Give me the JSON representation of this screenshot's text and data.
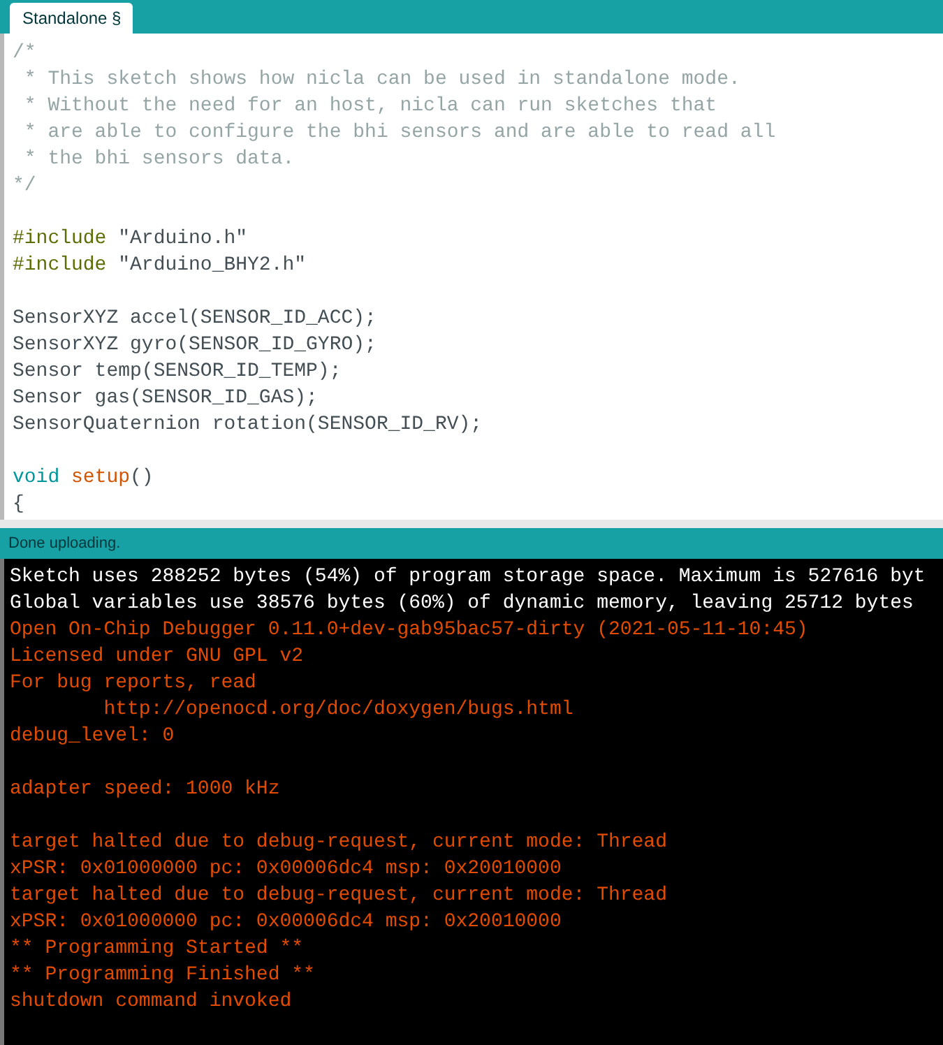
{
  "tabs": [
    {
      "label": "Standalone §",
      "selected": true
    }
  ],
  "editor": {
    "lines": [
      {
        "kind": "code",
        "segments": [
          {
            "text": "/*",
            "kind": "comment"
          }
        ]
      },
      {
        "kind": "code",
        "segments": [
          {
            "text": " * This sketch shows how nicla can be used in standalone mode.",
            "kind": "comment"
          }
        ]
      },
      {
        "kind": "code",
        "segments": [
          {
            "text": " * Without the need for an host, nicla can run sketches that",
            "kind": "comment"
          }
        ]
      },
      {
        "kind": "code",
        "segments": [
          {
            "text": " * are able to configure the bhi sensors and are able to read all",
            "kind": "comment"
          }
        ]
      },
      {
        "kind": "code",
        "segments": [
          {
            "text": " * the bhi sensors data.",
            "kind": "comment"
          }
        ]
      },
      {
        "kind": "code",
        "segments": [
          {
            "text": "*/",
            "kind": "comment"
          }
        ]
      },
      {
        "kind": "blank"
      },
      {
        "kind": "code",
        "segments": [
          {
            "text": "#include",
            "kind": "directive"
          },
          {
            "text": " \"Arduino.h\"",
            "kind": "plain"
          }
        ]
      },
      {
        "kind": "code",
        "segments": [
          {
            "text": "#include",
            "kind": "directive"
          },
          {
            "text": " \"Arduino_BHY2.h\"",
            "kind": "plain"
          }
        ]
      },
      {
        "kind": "blank"
      },
      {
        "kind": "code",
        "segments": [
          {
            "text": "SensorXYZ accel(SENSOR_ID_ACC);",
            "kind": "plain"
          }
        ]
      },
      {
        "kind": "code",
        "segments": [
          {
            "text": "SensorXYZ gyro(SENSOR_ID_GYRO);",
            "kind": "plain"
          }
        ]
      },
      {
        "kind": "code",
        "segments": [
          {
            "text": "Sensor temp(SENSOR_ID_TEMP);",
            "kind": "plain"
          }
        ]
      },
      {
        "kind": "code",
        "segments": [
          {
            "text": "Sensor gas(SENSOR_ID_GAS);",
            "kind": "plain"
          }
        ]
      },
      {
        "kind": "code",
        "segments": [
          {
            "text": "SensorQuaternion rotation(SENSOR_ID_RV);",
            "kind": "plain"
          }
        ]
      },
      {
        "kind": "blank"
      },
      {
        "kind": "code",
        "segments": [
          {
            "text": "void",
            "kind": "keyword"
          },
          {
            "text": " setup",
            "kind": "function"
          },
          {
            "text": "()",
            "kind": "plain"
          }
        ]
      },
      {
        "kind": "code",
        "segments": [
          {
            "text": "{",
            "kind": "plain"
          }
        ]
      }
    ]
  },
  "status_bar": {
    "message": "Done uploading."
  },
  "console": {
    "lines": [
      {
        "kind": "info",
        "text": "Sketch uses 288252 bytes (54%) of program storage space. Maximum is 527616 byt"
      },
      {
        "kind": "info",
        "text": "Global variables use 38576 bytes (60%) of dynamic memory, leaving 25712 bytes"
      },
      {
        "kind": "error",
        "text": "Open On-Chip Debugger 0.11.0+dev-gab95bac57-dirty (2021-05-11-10:45)"
      },
      {
        "kind": "error",
        "text": "Licensed under GNU GPL v2"
      },
      {
        "kind": "error",
        "text": "For bug reports, read"
      },
      {
        "kind": "error",
        "text": "        http://openocd.org/doc/doxygen/bugs.html"
      },
      {
        "kind": "error",
        "text": "debug_level: 0"
      },
      {
        "kind": "blank"
      },
      {
        "kind": "error",
        "text": "adapter speed: 1000 kHz"
      },
      {
        "kind": "blank"
      },
      {
        "kind": "error",
        "text": "target halted due to debug-request, current mode: Thread"
      },
      {
        "kind": "error",
        "text": "xPSR: 0x01000000 pc: 0x00006dc4 msp: 0x20010000"
      },
      {
        "kind": "error",
        "text": "target halted due to debug-request, current mode: Thread"
      },
      {
        "kind": "error",
        "text": "xPSR: 0x01000000 pc: 0x00006dc4 msp: 0x20010000"
      },
      {
        "kind": "error",
        "text": "** Programming Started **"
      },
      {
        "kind": "error",
        "text": "** Programming Finished **"
      },
      {
        "kind": "error",
        "text": "shutdown command invoked"
      }
    ]
  }
}
